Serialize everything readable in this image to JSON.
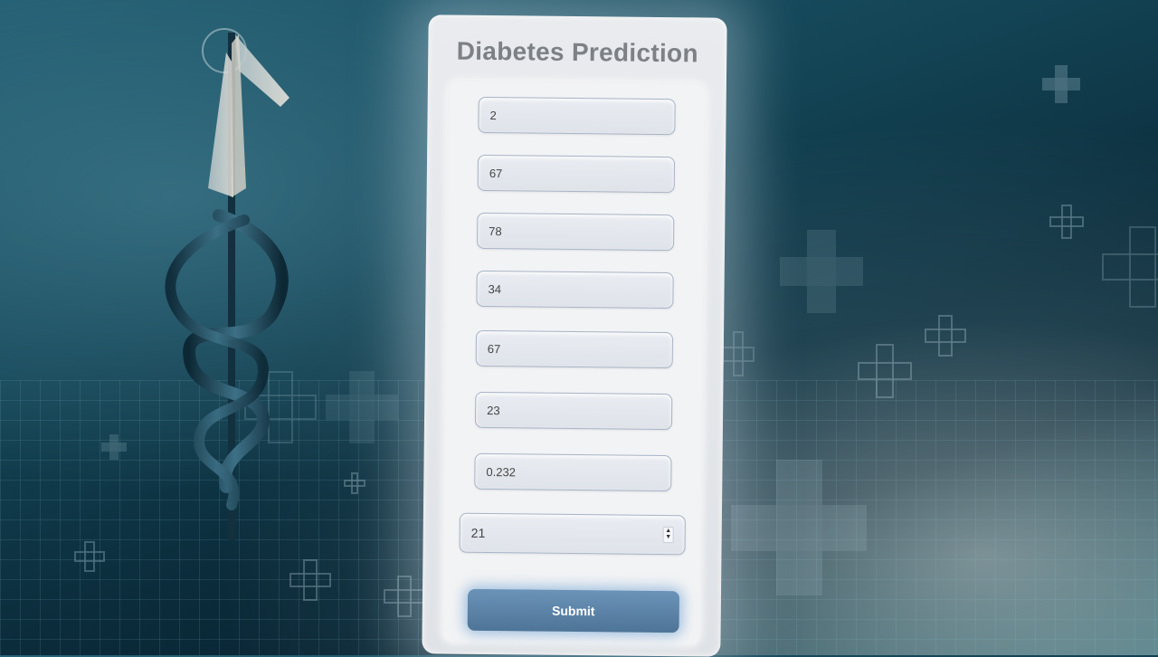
{
  "page": {
    "title": "Diabetes Prediction"
  },
  "form": {
    "fields": [
      {
        "value": "2"
      },
      {
        "value": "67"
      },
      {
        "value": "78"
      },
      {
        "value": "34"
      },
      {
        "value": "67"
      },
      {
        "value": "23"
      },
      {
        "value": "0.232"
      },
      {
        "value": "21"
      }
    ],
    "submit_label": "Submit"
  },
  "icons": {
    "background": [
      "medical-cross-icon",
      "caduceus-icon"
    ],
    "stepper": "number-stepper-icon"
  },
  "colors": {
    "background": "#134455",
    "card": "#e9ebee",
    "title": "#7d8186",
    "submit": "#5a82a7",
    "field_border": "#a7b4c6"
  }
}
